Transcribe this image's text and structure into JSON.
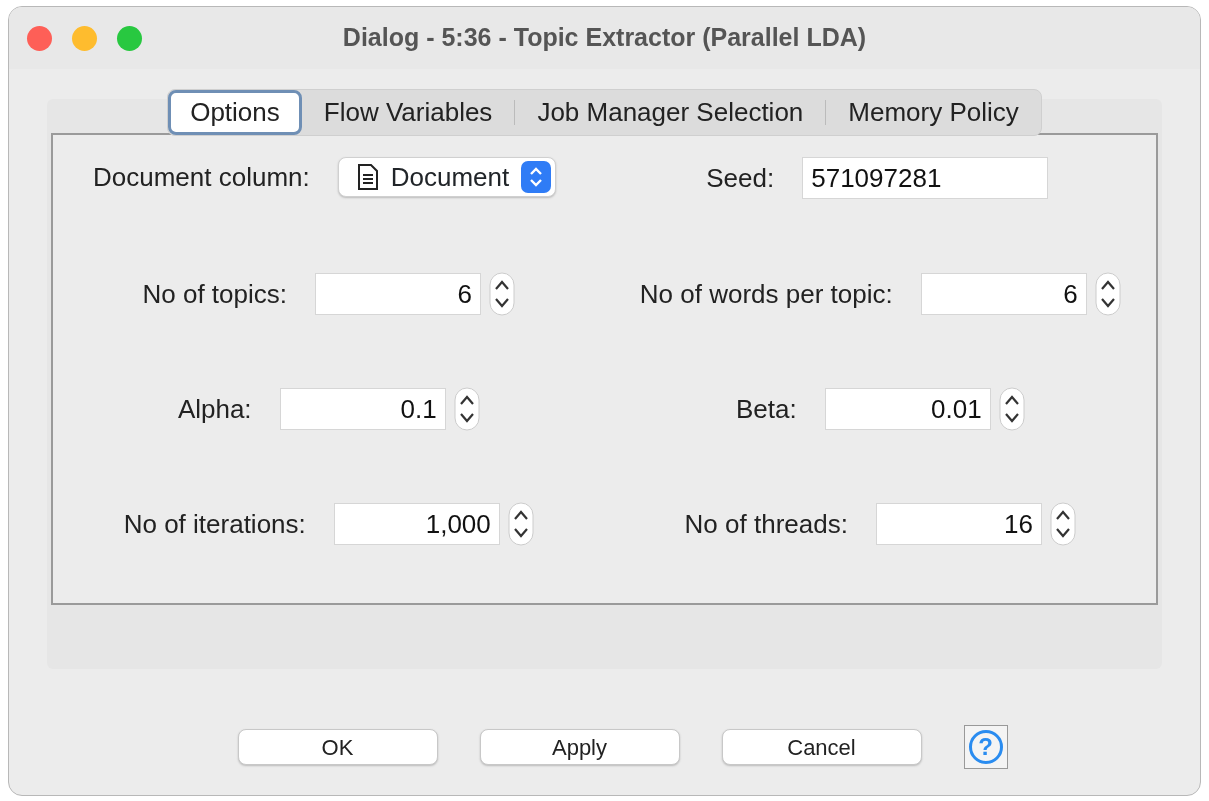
{
  "window": {
    "title": "Dialog - 5:36 - Topic Extractor (Parallel LDA)"
  },
  "tabs": [
    {
      "label": "Options",
      "selected": true
    },
    {
      "label": "Flow Variables",
      "selected": false
    },
    {
      "label": "Job Manager Selection",
      "selected": false
    },
    {
      "label": "Memory Policy",
      "selected": false
    }
  ],
  "rows": [
    [
      {
        "kind": "dropdown",
        "label": "Document column:",
        "value": "Document"
      },
      {
        "kind": "text",
        "label": "Seed:",
        "value": "571097281"
      }
    ],
    [
      {
        "kind": "spinner",
        "label": "No of topics:",
        "value": "6"
      },
      {
        "kind": "spinner",
        "label": "No of words per topic:",
        "value": "6"
      }
    ],
    [
      {
        "kind": "spinner",
        "label": "Alpha:",
        "value": "0.1"
      },
      {
        "kind": "spinner",
        "label": "Beta:",
        "value": "0.01"
      }
    ],
    [
      {
        "kind": "spinner",
        "label": "No of iterations:",
        "value": "1,000"
      },
      {
        "kind": "spinner",
        "label": "No of threads:",
        "value": "16"
      }
    ]
  ],
  "buttons": [
    "OK",
    "Apply",
    "Cancel"
  ],
  "help_button": {
    "label": "?"
  }
}
